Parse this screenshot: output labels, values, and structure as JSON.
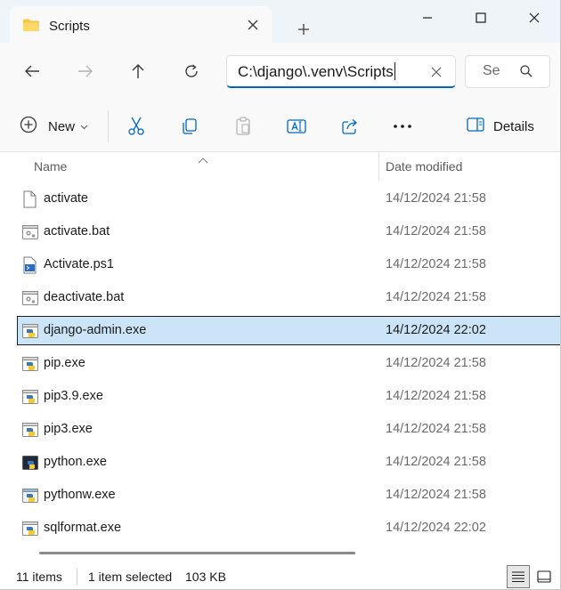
{
  "window": {
    "tab_title": "Scripts",
    "controls": {
      "minimize": "minimize",
      "maximize": "maximize",
      "close": "close"
    }
  },
  "nav": {
    "address": "C:\\django\\.venv\\Scripts",
    "search_placeholder": "Se"
  },
  "toolbar": {
    "new_label": "New",
    "details_label": "Details"
  },
  "columns": {
    "name": "Name",
    "date_modified": "Date modified"
  },
  "files": [
    {
      "name": "activate",
      "date": "14/12/2024 21:58",
      "icon": "file-icon",
      "selected": false
    },
    {
      "name": "activate.bat",
      "date": "14/12/2024 21:58",
      "icon": "batch-file-icon",
      "selected": false
    },
    {
      "name": "Activate.ps1",
      "date": "14/12/2024 21:58",
      "icon": "powershell-file-icon",
      "selected": false
    },
    {
      "name": "deactivate.bat",
      "date": "14/12/2024 21:58",
      "icon": "batch-file-icon",
      "selected": false
    },
    {
      "name": "django-admin.exe",
      "date": "14/12/2024 22:02",
      "icon": "python-exe-icon",
      "selected": true
    },
    {
      "name": "pip.exe",
      "date": "14/12/2024 21:58",
      "icon": "python-exe-icon",
      "selected": false
    },
    {
      "name": "pip3.9.exe",
      "date": "14/12/2024 21:58",
      "icon": "python-exe-icon",
      "selected": false
    },
    {
      "name": "pip3.exe",
      "date": "14/12/2024 21:58",
      "icon": "python-exe-icon",
      "selected": false
    },
    {
      "name": "python.exe",
      "date": "14/12/2024 21:58",
      "icon": "python-console-icon",
      "selected": false
    },
    {
      "name": "pythonw.exe",
      "date": "14/12/2024 21:58",
      "icon": "python-window-icon",
      "selected": false
    },
    {
      "name": "sqlformat.exe",
      "date": "14/12/2024 22:02",
      "icon": "python-exe-icon",
      "selected": false
    }
  ],
  "status": {
    "count": "11 items",
    "selection": "1 item selected",
    "size": "103 KB"
  },
  "colors": {
    "accent": "#0067c0",
    "selection_bg": "#cce4f7",
    "folder": "#f8c446"
  }
}
